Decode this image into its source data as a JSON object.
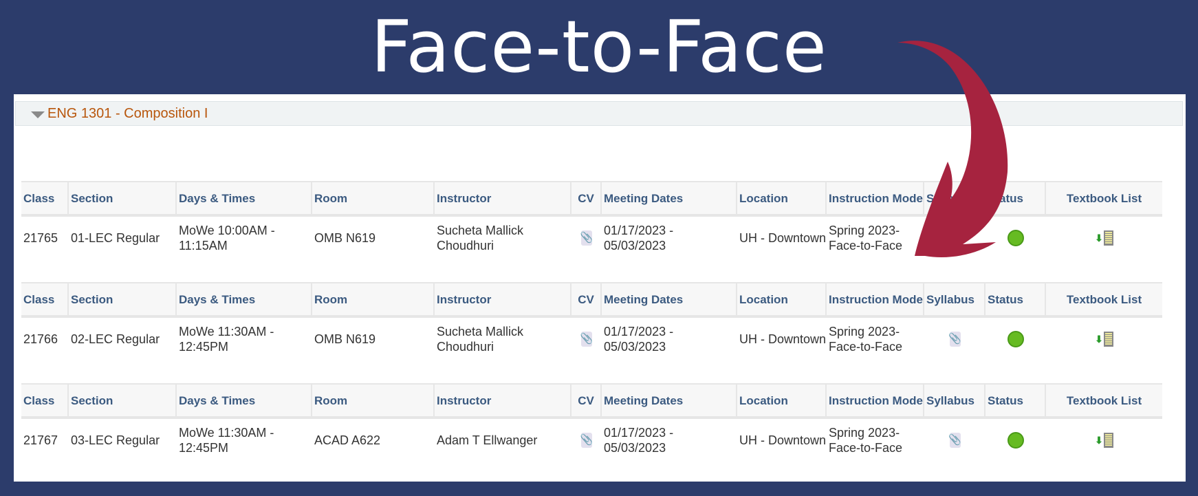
{
  "banner": {
    "title": "Face-to-Face"
  },
  "course": {
    "title": "ENG 1301 - Composition I"
  },
  "headers": [
    "Class",
    "Section",
    "Days & Times",
    "Room",
    "Instructor",
    "CV",
    "Meeting Dates",
    "Location",
    "Instruction Mode",
    "Syllabus",
    "Status",
    "Textbook List"
  ],
  "sections": [
    {
      "class": "21765",
      "section": "01-LEC Regular",
      "days_times": "MoWe 10:00AM - 11:15AM",
      "room": "OMB N619",
      "instructor": "Sucheta Mallick Choudhuri",
      "meeting_dates": "01/17/2023 - 05/03/2023",
      "location": "UH - Downtown",
      "mode": "Spring 2023-Face-to-Face",
      "has_syllabus": false,
      "status": "open"
    },
    {
      "class": "21766",
      "section": "02-LEC Regular",
      "days_times": "MoWe 11:30AM - 12:45PM",
      "room": "OMB N619",
      "instructor": "Sucheta Mallick Choudhuri",
      "meeting_dates": "01/17/2023 - 05/03/2023",
      "location": "UH - Downtown",
      "mode": "Spring 2023-Face-to-Face",
      "has_syllabus": true,
      "status": "open"
    },
    {
      "class": "21767",
      "section": "03-LEC Regular",
      "days_times": "MoWe 11:30AM - 12:45PM",
      "room": "ACAD A622",
      "instructor": "Adam T Ellwanger",
      "meeting_dates": "01/17/2023 - 05/03/2023",
      "location": "UH - Downtown",
      "mode": "Spring 2023-Face-to-Face",
      "has_syllabus": true,
      "status": "open"
    }
  ],
  "icons": {
    "cv": "paperclip-icon",
    "syllabus": "paperclip-icon",
    "status": "green-circle-icon",
    "textbook": "download-book-icon"
  },
  "colors": {
    "background": "#2c3c6b",
    "arrow": "#a6233f",
    "course_title": "#b8560c",
    "link": "#1f4f96",
    "status_open": "#66bb22"
  }
}
